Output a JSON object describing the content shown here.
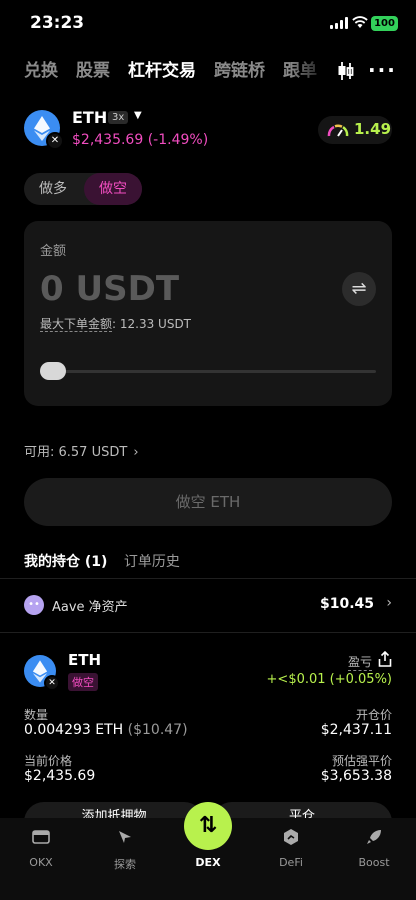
{
  "status": {
    "time": "23:23",
    "battery": "100"
  },
  "tabs": [
    {
      "label": "兑换",
      "active": false
    },
    {
      "label": "股票",
      "active": false
    },
    {
      "label": "杠杆交易",
      "active": true
    },
    {
      "label": "跨链桥",
      "active": false
    },
    {
      "label": "跟单",
      "active": false
    }
  ],
  "token": {
    "name": "ETH",
    "leverage": "3x",
    "price": "$2,435.69 (-1.49%)",
    "gauge_value": "1.49"
  },
  "toggle": {
    "long": "做多",
    "short": "做空"
  },
  "amount_card": {
    "label": "金额",
    "amount": "0 USDT",
    "max_label": "最大下单金额",
    "max_value": ": 12.33 USDT",
    "slider_value": 0
  },
  "available": "可用: 6.57 USDT",
  "submit_label": "做空 ETH",
  "positions_tabs": {
    "holdings": "我的持仓 (1)",
    "history": "订单历史"
  },
  "aave": {
    "label": "Aave 净资产",
    "value": "$10.45"
  },
  "position": {
    "name": "ETH",
    "side": "做空",
    "pnl_label": "盈亏",
    "pnl_value": "+<$0.01 (+0.05%)",
    "qty_label": "数量",
    "qty_value": "0.004293 ETH",
    "qty_usd": "($10.47)",
    "entry_label": "开仓价",
    "entry_value": "$2,437.11",
    "current_label": "当前价格",
    "current_value": "$2,435.69",
    "liq_label": "预估强平价",
    "liq_value": "$3,653.38",
    "action_add": "添加抵押物",
    "action_close": "平仓"
  },
  "nav": [
    {
      "label": "OKX",
      "icon": "wallet-icon",
      "active": false
    },
    {
      "label": "探索",
      "icon": "compass-icon",
      "active": false
    },
    {
      "label": "DEX",
      "icon": "swap-arrows-icon",
      "active": true
    },
    {
      "label": "DeFi",
      "icon": "defi-icon",
      "active": false
    },
    {
      "label": "Boost",
      "icon": "rocket-icon",
      "active": false
    }
  ],
  "colors": {
    "accent": "#b8f14d",
    "short": "#f14dc0",
    "eth": "#3b8df2"
  }
}
